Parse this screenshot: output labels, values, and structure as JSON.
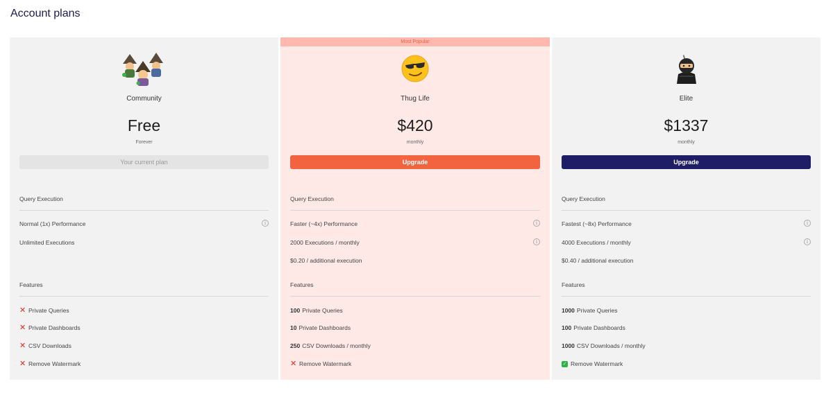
{
  "page": {
    "title": "Account plans"
  },
  "plans": [
    {
      "name": "Community",
      "price": "Free",
      "period": "Forever",
      "cta": "Your current plan",
      "emoji_icon": "wizard-group-icon",
      "query_execution_title": "Query Execution",
      "performance": "Normal (1x) Performance",
      "executions": "Unlimited Executions",
      "additional": "",
      "features_title": "Features",
      "features": [
        {
          "num": "",
          "label": "Private Queries",
          "status": "x"
        },
        {
          "num": "",
          "label": "Private Dashboards",
          "status": "x"
        },
        {
          "num": "",
          "label": "CSV Downloads",
          "status": "x"
        },
        {
          "num": "",
          "label": "Remove Watermark",
          "status": "x"
        }
      ]
    },
    {
      "badge": "Most Popular",
      "name": "Thug Life",
      "price": "$420",
      "period": "monthly",
      "cta": "Upgrade",
      "emoji_icon": "sunglasses-face-icon",
      "query_execution_title": "Query Execution",
      "performance": "Faster (~4x) Performance",
      "executions": "2000 Executions / monthly",
      "additional": "$0.20 / additional execution",
      "features_title": "Features",
      "features": [
        {
          "num": "100",
          "label": "Private Queries",
          "status": "num"
        },
        {
          "num": "10",
          "label": "Private Dashboards",
          "status": "num"
        },
        {
          "num": "250",
          "label": "CSV Downloads / monthly",
          "status": "num"
        },
        {
          "num": "",
          "label": "Remove Watermark",
          "status": "x"
        }
      ]
    },
    {
      "name": "Elite",
      "price": "$1337",
      "period": "monthly",
      "cta": "Upgrade",
      "emoji_icon": "ninja-icon",
      "query_execution_title": "Query Execution",
      "performance": "Fastest (~8x) Performance",
      "executions": "4000 Executions / monthly",
      "additional": "$0.40 / additional execution",
      "features_title": "Features",
      "features": [
        {
          "num": "1000",
          "label": "Private Queries",
          "status": "num"
        },
        {
          "num": "100",
          "label": "Private Dashboards",
          "status": "num"
        },
        {
          "num": "1000",
          "label": "CSV Downloads / monthly",
          "status": "num"
        },
        {
          "num": "",
          "label": "Remove Watermark",
          "status": "check"
        }
      ]
    }
  ],
  "colors": {
    "title": "#1b1c4e",
    "orange": "#f26440",
    "navy": "#1e1d66",
    "highlight_bg": "#ffe9e6",
    "card_bg": "#f2f2f2"
  }
}
